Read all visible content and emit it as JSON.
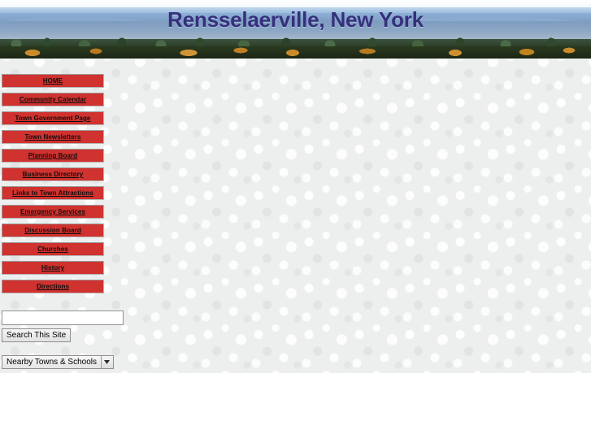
{
  "banner": {
    "title": "Rensselaerville, New York",
    "title_color": "#35307d",
    "image_alt": "autumn-hillside-panorama"
  },
  "nav": {
    "button_color": "#d0322f",
    "items": [
      {
        "label": "HOME",
        "name": "nav-home"
      },
      {
        "label": "Community Calendar",
        "name": "nav-community-calendar"
      },
      {
        "label": "Town Government Page",
        "name": "nav-town-government-page"
      },
      {
        "label": "Town Newsletters",
        "name": "nav-town-newsletters"
      },
      {
        "label": "Planning Board",
        "name": "nav-planning-board"
      },
      {
        "label": "Business Directory",
        "name": "nav-business-directory"
      },
      {
        "label": "Links to Town Attractions",
        "name": "nav-links-to-town-attractions"
      },
      {
        "label": "Emergency Services",
        "name": "nav-emergency-services"
      },
      {
        "label": "Discussion Board",
        "name": "nav-discussion-board"
      },
      {
        "label": "Churches",
        "name": "nav-churches"
      },
      {
        "label": "History",
        "name": "nav-history"
      },
      {
        "label": "Directions",
        "name": "nav-directions"
      }
    ]
  },
  "search": {
    "value": "",
    "placeholder": "",
    "button_label": "Search This Site"
  },
  "dropdown": {
    "selected": "Nearby Towns & Schools",
    "arrow_icon": "chevron-down-icon"
  }
}
